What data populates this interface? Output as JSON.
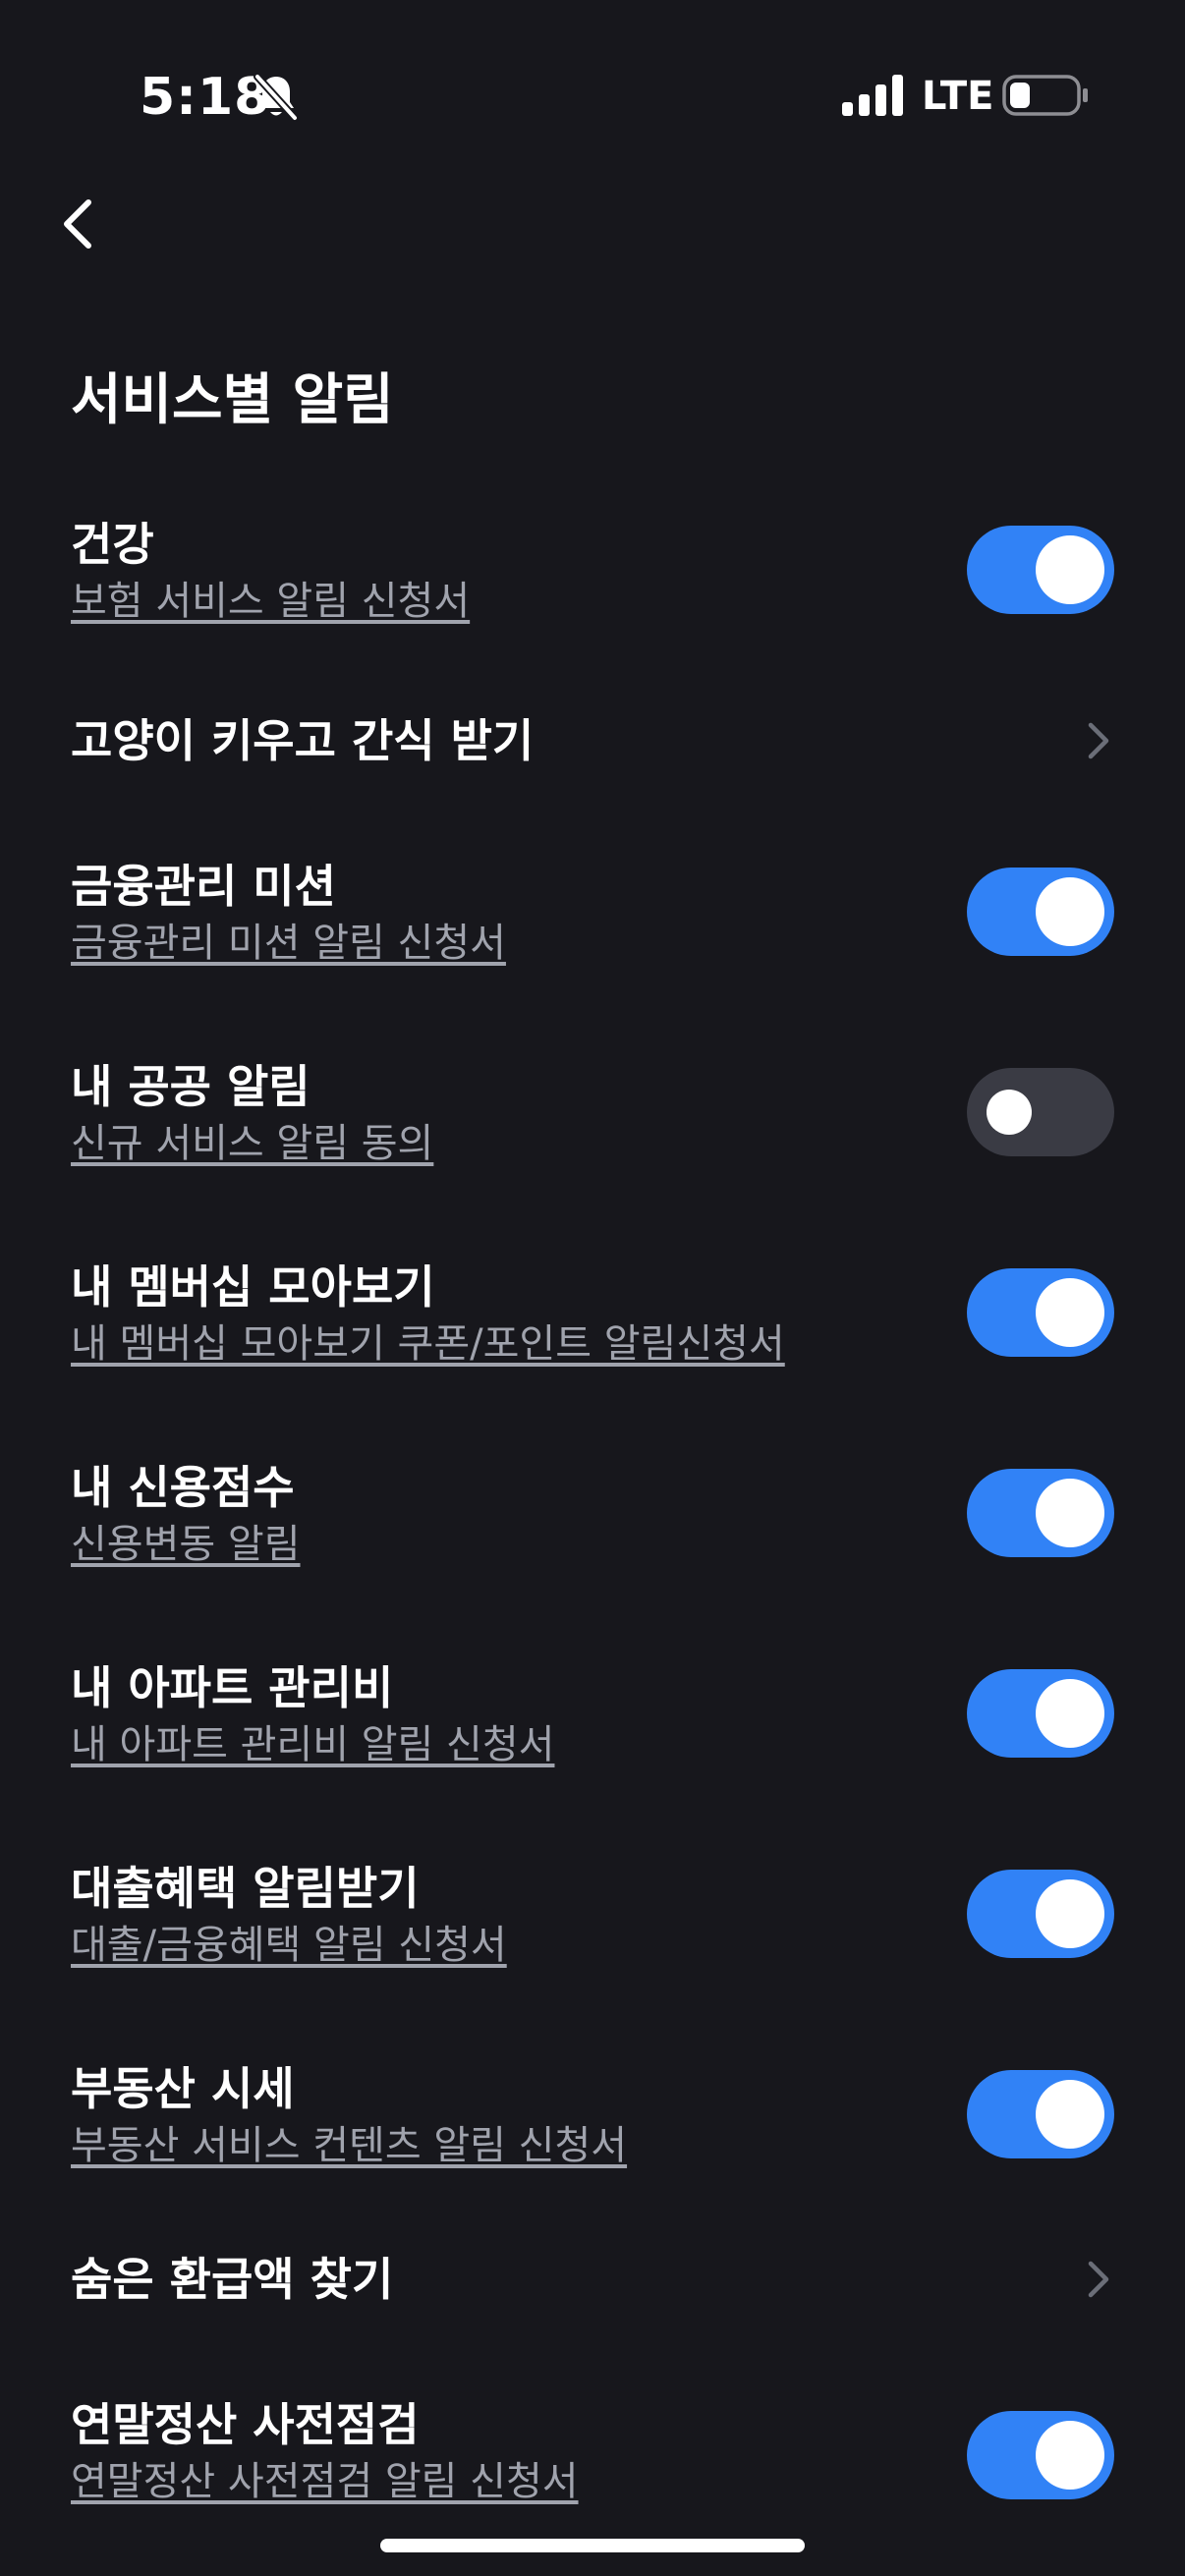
{
  "status_bar": {
    "time": "5:18",
    "network": "LTE",
    "icons": [
      "bell-slash-icon",
      "signal-icon",
      "battery-icon"
    ]
  },
  "header": {
    "back_icon": "chevron-left-icon",
    "title": "서비스별 알림"
  },
  "items": [
    {
      "title": "건강",
      "subtitle": "보험 서비스 알림 신청서",
      "control": "toggle",
      "on": true
    },
    {
      "title": "고양이 키우고 간식 받기",
      "subtitle": "",
      "control": "chevron"
    },
    {
      "title": "금융관리 미션",
      "subtitle": "금융관리 미션 알림 신청서",
      "control": "toggle",
      "on": true
    },
    {
      "title": "내 공공 알림",
      "subtitle": "신규 서비스 알림 동의",
      "control": "toggle",
      "on": false
    },
    {
      "title": "내 멤버십 모아보기",
      "subtitle": "내 멤버십 모아보기 쿠폰/포인트 알림신청서",
      "control": "toggle",
      "on": true
    },
    {
      "title": "내 신용점수",
      "subtitle": "신용변동 알림",
      "control": "toggle",
      "on": true
    },
    {
      "title": "내 아파트 관리비",
      "subtitle": "내 아파트 관리비 알림 신청서",
      "control": "toggle",
      "on": true
    },
    {
      "title": "대출혜택 알림받기",
      "subtitle": "대출/금융혜택 알림 신청서",
      "control": "toggle",
      "on": true
    },
    {
      "title": "부동산 시세",
      "subtitle": "부동산 서비스  컨텐츠 알림 신청서",
      "control": "toggle",
      "on": true
    },
    {
      "title": "숨은 환급액 찾기",
      "subtitle": "",
      "control": "chevron"
    },
    {
      "title": "연말정산 사전점검",
      "subtitle": "연말정산 사전점검  알림 신청서",
      "control": "toggle",
      "on": true
    }
  ],
  "colors": {
    "background": "#17171c",
    "accent": "#3182f6",
    "toggle_off": "#3a3b44",
    "subtitle": "#a0a3ad"
  }
}
